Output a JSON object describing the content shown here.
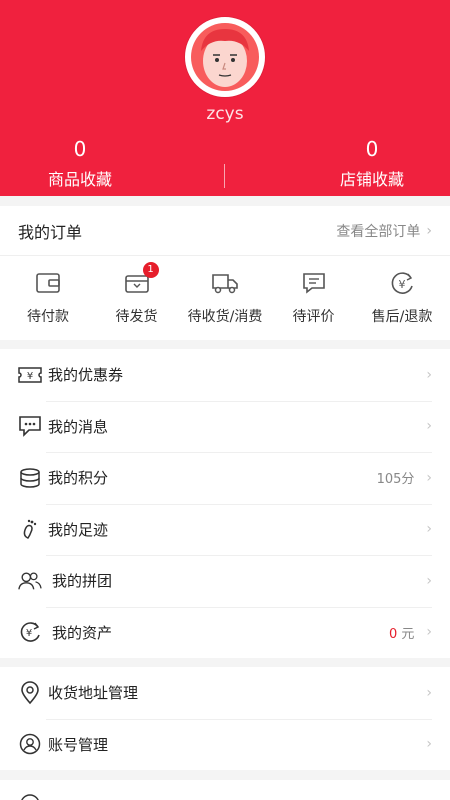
{
  "profile": {
    "username": "zcys",
    "stats": [
      {
        "num": "0",
        "label": "商品收藏"
      },
      {
        "num": "0",
        "label": "店铺收藏"
      }
    ]
  },
  "orders": {
    "title": "我的订单",
    "view_all": "查看全部订单",
    "items": [
      {
        "label": "待付款",
        "icon": "wallet-icon"
      },
      {
        "label": "待发货",
        "icon": "package-icon",
        "badge": "1"
      },
      {
        "label": "待收货/消费",
        "icon": "truck-icon"
      },
      {
        "label": "待评价",
        "icon": "comment-icon"
      },
      {
        "label": "售后/退款",
        "icon": "refund-icon"
      }
    ]
  },
  "menu": [
    {
      "label": "我的优惠券",
      "icon": "coupon-icon"
    },
    {
      "label": "我的消息",
      "icon": "message-icon"
    },
    {
      "label": "我的积分",
      "icon": "points-icon",
      "value": "105分"
    },
    {
      "label": "我的足迹",
      "icon": "footprint-icon"
    },
    {
      "label": "我的拼团",
      "icon": "group-icon"
    },
    {
      "label": "我的资产",
      "icon": "assets-icon",
      "value_num": "0",
      "value_unit": "元"
    }
  ],
  "menu2": [
    {
      "label": "收货地址管理",
      "icon": "location-icon"
    },
    {
      "label": "账号管理",
      "icon": "account-icon"
    }
  ],
  "colors": {
    "brand": "#f0213e",
    "accent_red": "#e61e2b"
  }
}
